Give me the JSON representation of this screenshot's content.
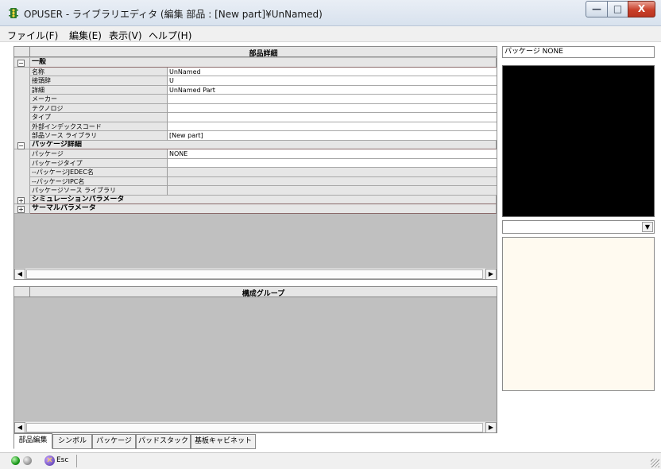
{
  "window": {
    "title": "OPUSER - ライブラリエディタ (編集 部品 : [New part]¥UnNamed)",
    "minimize_glyph": "—",
    "maximize_glyph": "□",
    "close_glyph": "X"
  },
  "menu": {
    "file": "ファイル(F)",
    "edit": "編集(E)",
    "view": "表示(V)",
    "help": "ヘルプ(H)"
  },
  "part_details": {
    "header": "部品詳細",
    "general": {
      "label": "一般",
      "toggle": "−",
      "rows": [
        {
          "name": "名称",
          "value": "UnNamed"
        },
        {
          "name": "接頭辞",
          "value": "U"
        },
        {
          "name": "詳細",
          "value": "UnNamed Part"
        },
        {
          "name": "メーカー",
          "value": ""
        },
        {
          "name": "テクノロジ",
          "value": ""
        },
        {
          "name": "タイプ",
          "value": ""
        },
        {
          "name": "外部インデックスコード",
          "value": ""
        },
        {
          "name": "部品ソース ライブラリ",
          "value": "[New part]"
        }
      ]
    },
    "package": {
      "label": "パッケージ詳細",
      "toggle": "−",
      "rows": [
        {
          "name": "パッケージ",
          "value": "NONE"
        },
        {
          "name": "パッケージタイプ",
          "value": ""
        },
        {
          "name": "--パッケージJEDEC名",
          "value": ""
        },
        {
          "name": "--パッケージIPC名",
          "value": ""
        },
        {
          "name": "パッケージソース ライブラリ",
          "value": ""
        }
      ]
    },
    "simulation": {
      "label": "シミュレーションパラメータ",
      "toggle": "+"
    },
    "thermal": {
      "label": "サーマルパラメータ",
      "toggle": "+"
    }
  },
  "groups": {
    "header": "構成グループ"
  },
  "right_panel": {
    "package_label": "パッケージ NONE"
  },
  "scroll": {
    "left_arrow": "◀",
    "right_arrow": "▶",
    "down_arrow": "▼"
  },
  "tabs": [
    {
      "label": "部品編集"
    },
    {
      "label": "シンボル"
    },
    {
      "label": "パッケージ"
    },
    {
      "label": "パッドスタック"
    },
    {
      "label": "基板キャビネット"
    }
  ],
  "status": {
    "esc_label": "Esc",
    "esc_glyph": "✕"
  },
  "colors": {
    "preview_background": "#000000",
    "notes_background": "#fffaf0",
    "title_bar": "#dfe7f1",
    "close_button": "#c9402a"
  }
}
